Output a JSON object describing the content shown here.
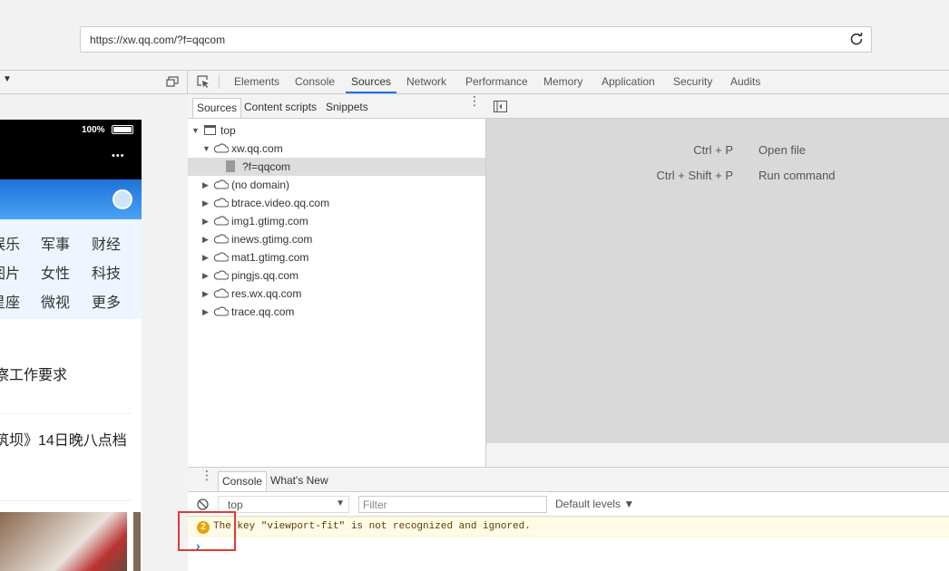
{
  "url": "https://xw.qq.com/?f=qqcom",
  "devtools_tabs": [
    "Elements",
    "Console",
    "Sources",
    "Network",
    "Performance",
    "Memory",
    "Application",
    "Security",
    "Audits"
  ],
  "active_tab": "Sources",
  "navigator_tabs": [
    "Sources",
    "Content scripts",
    "Snippets"
  ],
  "tree": {
    "top": "top",
    "origin": "xw.qq.com",
    "file": "?f=qqcom",
    "domains": [
      "(no domain)",
      "btrace.video.qq.com",
      "img1.gtimg.com",
      "inews.gtimg.com",
      "mat1.gtimg.com",
      "pingjs.qq.com",
      "res.wx.qq.com",
      "trace.qq.com"
    ]
  },
  "shortcuts": [
    {
      "keys": "Ctrl + P",
      "action": "Open file"
    },
    {
      "keys": "Ctrl + Shift + P",
      "action": "Run command"
    }
  ],
  "drawer_tabs": [
    "Console",
    "What's New"
  ],
  "console": {
    "context": "top",
    "filter_placeholder": "Filter",
    "levels": "Default levels ▼",
    "warning_count": "2",
    "warning_text": "The key \"viewport-fit\" is not recognized and ignored.",
    "prompt": "›"
  },
  "phone": {
    "battery": "100%",
    "menu_dots": "•••",
    "categories": [
      [
        "娱乐",
        "军事",
        "财经"
      ],
      [
        "图片",
        "女性",
        "科技"
      ],
      [
        "星座",
        "微视",
        "更多"
      ]
    ],
    "news": [
      "察工作要求",
      "筑坝》14日晚八点档"
    ]
  }
}
